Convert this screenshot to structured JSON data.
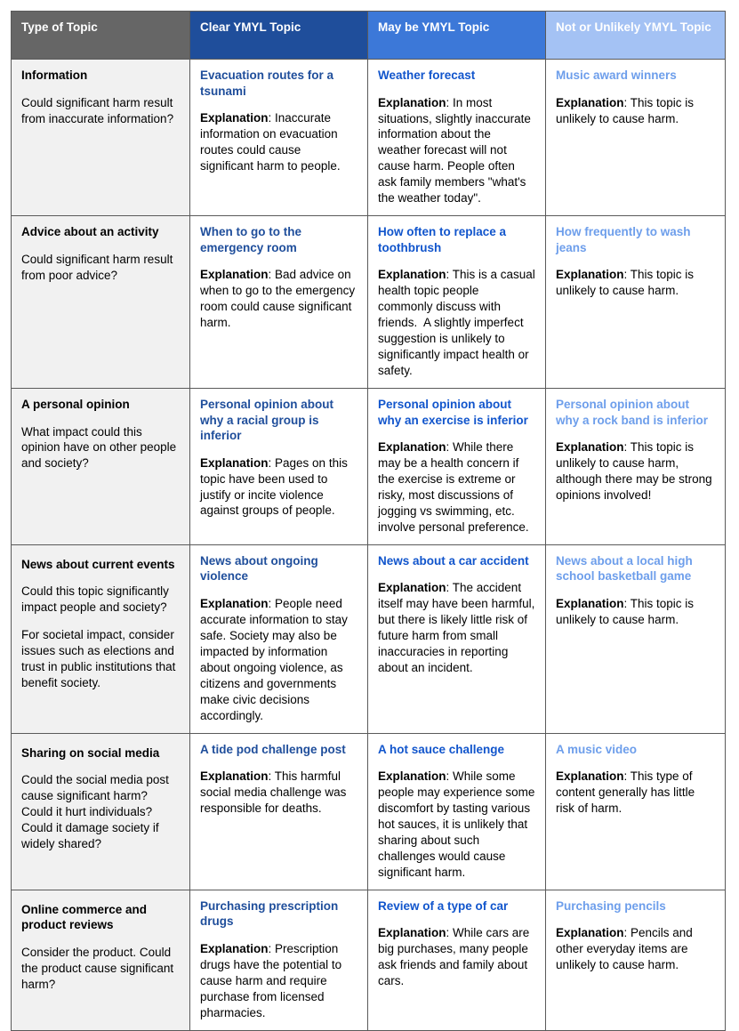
{
  "table": {
    "columns": [
      {
        "key": "type",
        "label": "Type of Topic",
        "header_bg": "#666666",
        "text_color": "#ffffff"
      },
      {
        "key": "clear",
        "label": "Clear YMYL Topic",
        "header_bg": "#1f4e9b",
        "text_color": "#ffffff"
      },
      {
        "key": "maybe",
        "label": "May be YMYL Topic",
        "header_bg": "#3c78d8",
        "text_color": "#ffffff"
      },
      {
        "key": "not",
        "label": "Not or Unlikely YMYL Topic",
        "header_bg": "#a4c2f4",
        "text_color": "#ffffff"
      }
    ],
    "explanation_label": "Explanation",
    "rows": [
      {
        "type_title": "Information",
        "type_sub_1": "Could significant harm result from inaccurate information?",
        "type_sub_2": "",
        "clear_title": "Evacuation routes for a tsunami",
        "clear_expl": ": Inaccurate information on evacuation routes could cause significant harm to people.",
        "maybe_title": "Weather forecast",
        "maybe_expl": ": In most situations, slightly inaccurate information about the weather forecast will not cause harm. People often ask family members \"what's the weather today\".",
        "not_title": "Music award winners",
        "not_expl": ": This topic is unlikely to cause harm."
      },
      {
        "type_title": "Advice about an activity",
        "type_sub_1": "Could significant harm result from poor advice?",
        "type_sub_2": "",
        "clear_title": "When to go to the emergency room",
        "clear_expl": ": Bad advice on when to go to the emergency room could cause significant harm.",
        "maybe_title": "How often to replace a toothbrush",
        "maybe_expl": ": This is a casual health topic people commonly discuss with friends.  A slightly imperfect suggestion is unlikely to significantly impact health or safety.",
        "not_title": "How frequently to wash jeans",
        "not_expl": ": This topic is unlikely to cause harm."
      },
      {
        "type_title": "A personal opinion",
        "type_sub_1": "What impact could this opinion have on other people and society?",
        "type_sub_2": "",
        "clear_title": "Personal opinion about why a racial group is inferior",
        "clear_expl": ": Pages on this topic have been used to justify or incite violence against groups of people.",
        "maybe_title": "Personal opinion about why an exercise is inferior",
        "maybe_expl": ": While there may be a health concern if the exercise is extreme or risky, most discussions of jogging vs swimming, etc. involve personal preference.",
        "not_title": "Personal opinion about why a rock band is inferior",
        "not_expl": ": This topic is unlikely to cause harm, although there may be strong opinions involved!"
      },
      {
        "type_title": "News about current events",
        "type_sub_1": "Could this topic significantly impact people and society?",
        "type_sub_2": "For societal impact, consider issues such as elections and trust in public institutions that benefit society.",
        "clear_title": "News about ongoing violence",
        "clear_expl": ": People need accurate information to stay safe. Society may also be impacted by information about ongoing violence, as citizens and governments make civic decisions accordingly.",
        "maybe_title": "News about a car accident",
        "maybe_expl": ": The accident itself may have been harmful, but there is likely little risk of future harm from small inaccuracies in reporting about an incident.",
        "not_title": "News about a local high school basketball game",
        "not_expl": ": This topic is unlikely to cause harm."
      },
      {
        "type_title": "Sharing on social media",
        "type_sub_1": "Could the social media post cause significant harm? Could it hurt individuals? Could it damage society if widely shared?",
        "type_sub_2": "",
        "clear_title": "A tide pod challenge post",
        "clear_expl": ": This harmful social media challenge was responsible for deaths.",
        "maybe_title": "A hot sauce challenge",
        "maybe_expl": ": While some people may experience some discomfort by tasting various hot sauces, it is unlikely that sharing about such challenges would cause significant harm.",
        "not_title": "A music video",
        "not_expl": ": This type of content generally has little risk of harm."
      },
      {
        "type_title": "Online commerce and product reviews",
        "type_sub_1": "Consider the product. Could the product cause significant harm?",
        "type_sub_2": "",
        "clear_title": "Purchasing prescription drugs",
        "clear_expl": ": Prescription drugs have the potential to cause harm and require purchase from licensed pharmacies.",
        "maybe_title": "Review of a type of car",
        "maybe_expl": ": While cars are big purchases, many people ask friends and family about cars.",
        "not_title": "Purchasing pencils",
        "not_expl": ": Pencils and other everyday items are unlikely to cause harm."
      }
    ]
  }
}
